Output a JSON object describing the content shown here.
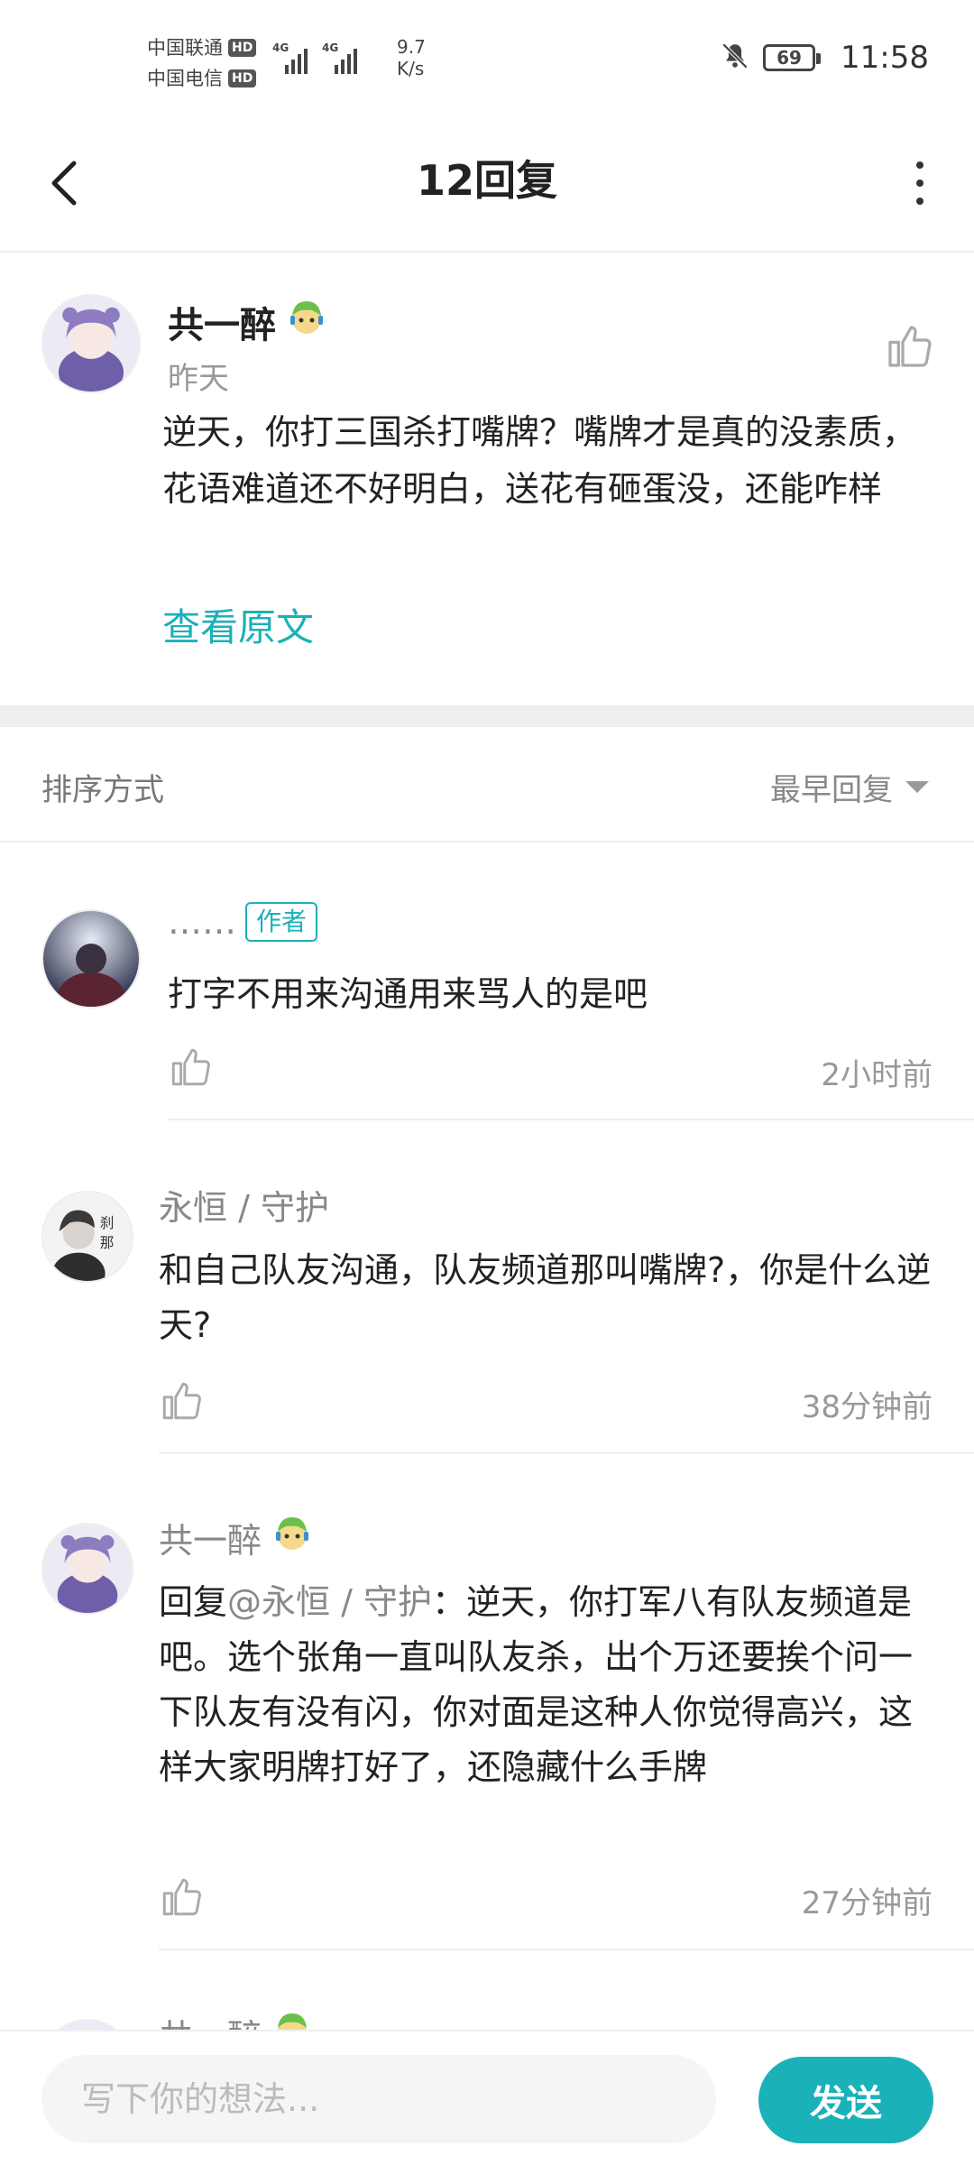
{
  "status_bar": {
    "carrier1": "中国联通",
    "carrier2": "中国电信",
    "hd_badge": "HD",
    "network_tag": "4G",
    "net_speed_value": "9.7",
    "net_speed_unit": "K/s",
    "battery": "69",
    "time": "11:58"
  },
  "header": {
    "title": "12回复"
  },
  "main_post": {
    "username": "共一醉",
    "time": "昨天",
    "content": "逆天，你打三国杀打嘴牌？嘴牌才是真的没素质，花语难道还不好明白，送花有砸蛋没，还能咋样",
    "view_original": "查看原文"
  },
  "sort": {
    "label": "排序方式",
    "selected": "最早回复"
  },
  "replies": [
    {
      "username": "……",
      "badge": "作者",
      "content": "打字不用来沟通用来骂人的是吧",
      "time": "2小时前"
    },
    {
      "username": "永恒 / 守护",
      "content": "和自己队友沟通，队友频道那叫嘴牌?，你是什么逆天?",
      "time": "38分钟前"
    },
    {
      "username": "共一醉",
      "reply_prefix": "回复",
      "mention": "@永恒 / 守护",
      "content": "：逆天，你打军八有队友频道是吧。选个张角一直叫队友杀，出个万还要挨个问一下队友有没有闪，你对面是这种人你觉得高兴，这样大家明牌打好了，还隐藏什么手牌",
      "time": "27分钟前"
    },
    {
      "username": "共一醉"
    }
  ],
  "bottom": {
    "input_placeholder": "写下你的想法...",
    "send_label": "发送"
  },
  "colors": {
    "accent": "#1ab1b9",
    "divider": "#efefef"
  }
}
